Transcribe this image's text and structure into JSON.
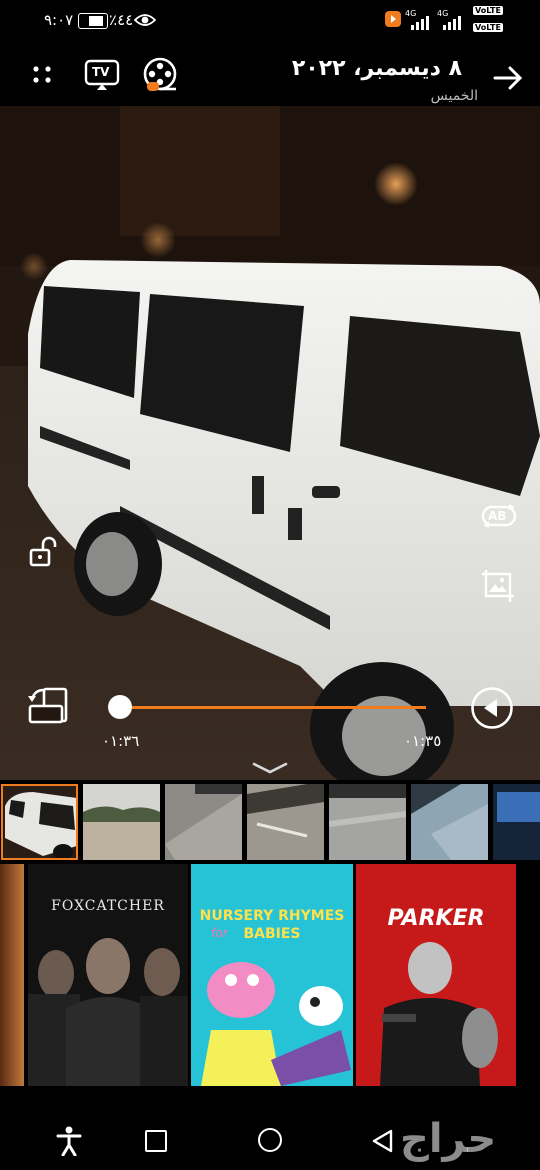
{
  "status_bar": {
    "time": "٩:٠٧",
    "battery": "٪٤٤",
    "net_label_1": "4G",
    "net_label_2": "4G",
    "volte_1": "VoLTE",
    "volte_2": "VoLTE"
  },
  "header": {
    "date": "٨ ديسمبر، ٢٠٢٢",
    "weekday": "الخميس",
    "cast_label": "TV"
  },
  "player": {
    "elapsed": "٠١:٣٥",
    "total": "٠١:٣٦",
    "progress": 0.0,
    "ab_label": "AB",
    "accent_color": "#f07c1e"
  },
  "filmstrip": {
    "thumbs": [
      "van-selected",
      "trees",
      "stone-ground",
      "floor",
      "grey-floor",
      "blue-floor",
      "blue-screen"
    ]
  },
  "posters": [
    {
      "title": ""
    },
    {
      "title": "FOXCATCHER"
    },
    {
      "title_line1": "NURSERY RHYMES",
      "title_line2": "for",
      "title_line3": "BABIES"
    },
    {
      "title": "PARKER"
    }
  ],
  "watermark": {
    "text": "حراج"
  }
}
